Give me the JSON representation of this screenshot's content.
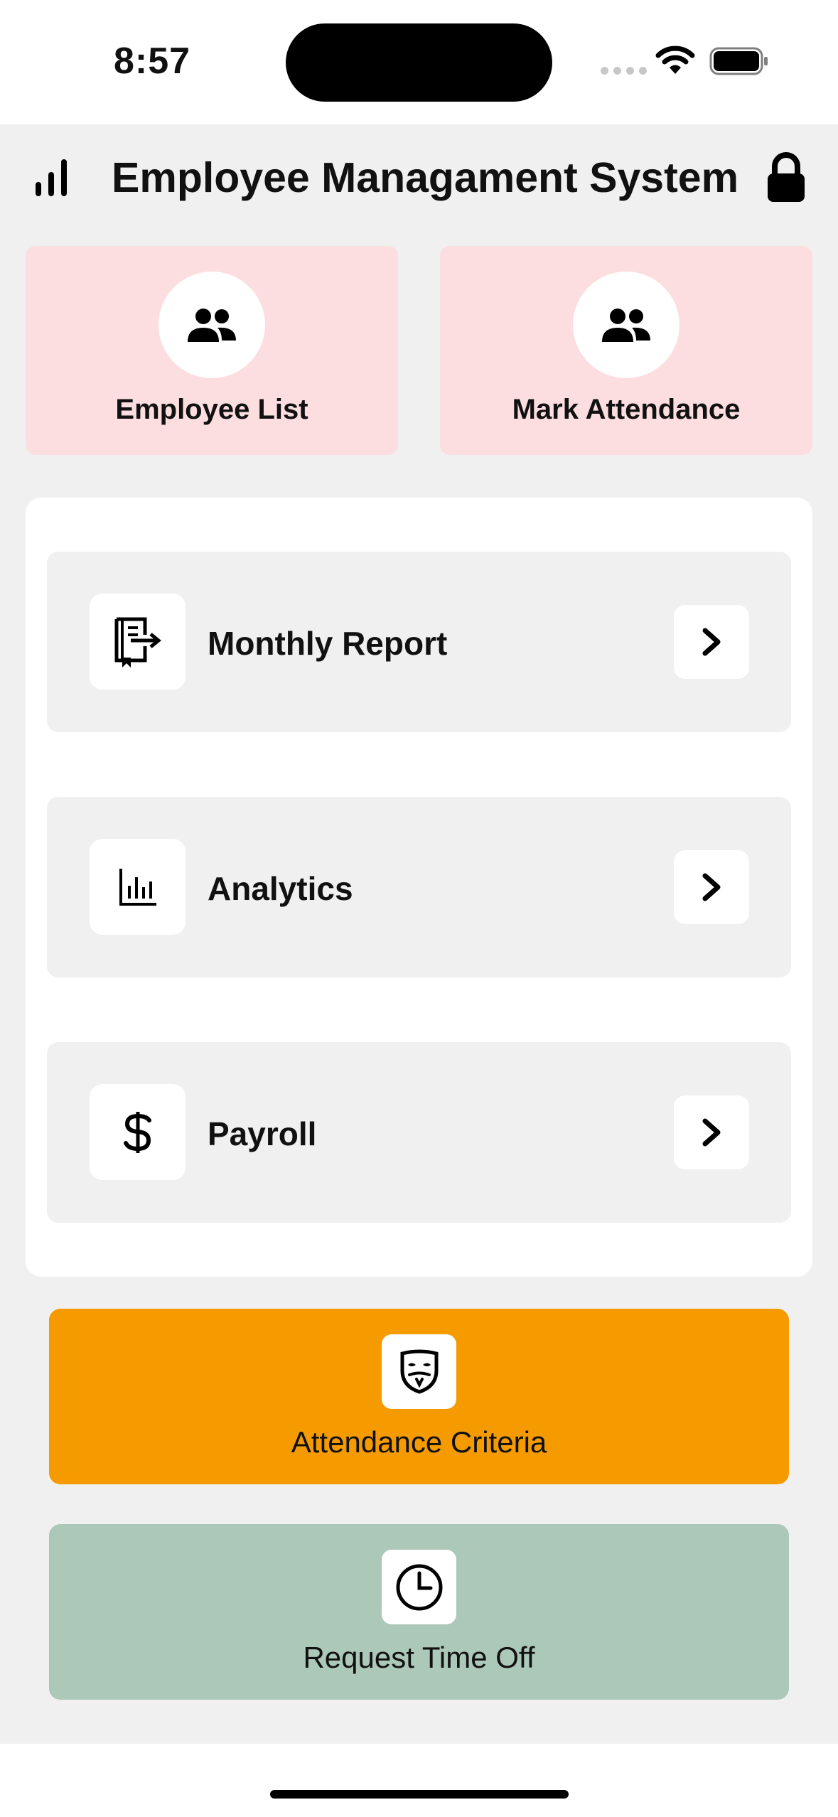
{
  "status_bar": {
    "time": "8:57"
  },
  "header": {
    "title": "Employee Managament System"
  },
  "top_cards": [
    {
      "label": "Employee List",
      "icon": "people-icon"
    },
    {
      "label": "Mark Attendance",
      "icon": "people-icon"
    }
  ],
  "menu": [
    {
      "label": "Monthly Report",
      "icon": "report-export-icon"
    },
    {
      "label": "Analytics",
      "icon": "bar-chart-icon"
    },
    {
      "label": "Payroll",
      "icon": "dollar-icon"
    }
  ],
  "actions": [
    {
      "label": "Attendance Criteria",
      "icon": "mask-icon",
      "color": "#f59b00"
    },
    {
      "label": "Request Time Off",
      "icon": "clock-icon",
      "color": "#abc8b8"
    }
  ],
  "colors": {
    "card_pink": "#fcdde0",
    "screen_bg": "#f0f0f0"
  }
}
